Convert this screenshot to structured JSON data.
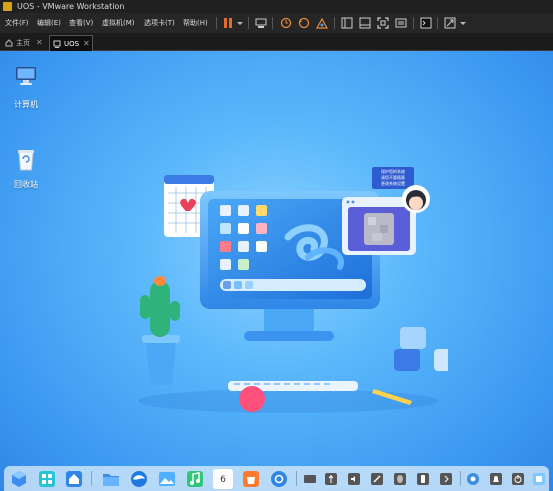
{
  "window": {
    "title": "UOS - VMware Workstation"
  },
  "menu": {
    "items": [
      "文件(F)",
      "编辑(E)",
      "查看(V)",
      "虚拟机(M)",
      "选项卡(T)",
      "帮助(H)"
    ]
  },
  "toolbar": {
    "icons": [
      "pause-icon",
      "dropdown-arrow-icon",
      "send-ctrl-alt-del-icon",
      "snapshot-icon",
      "revert-snapshot-icon",
      "snapshot-manager-icon",
      "library-view-icon",
      "unity-view-icon",
      "fullscreen-icon",
      "fit-guest-icon",
      "console-view-icon",
      "stretch-view-icon",
      "dropdown-arrow-icon"
    ]
  },
  "tabs": [
    {
      "label": "主页",
      "icon": "home-icon"
    },
    {
      "label": "UOS",
      "icon": "vm-icon"
    }
  ],
  "desktop": {
    "icons": [
      {
        "label": "计算机",
        "icon": "computer-icon"
      },
      {
        "label": "回收站",
        "icon": "trash-icon"
      }
    ],
    "illustration": {
      "bubble_text": [
        "保护您的系统",
        "请您不要随意",
        "更改系统设置"
      ]
    }
  },
  "dock": {
    "apps": [
      "multitasking-view-icon",
      "launcher-icon",
      "file-manager-icon",
      "browser-icon",
      "image-viewer-icon",
      "music-icon",
      "calendar-icon",
      "app-store-icon",
      "settings-icon"
    ],
    "tray": [
      "keyboard-icon",
      "usb-icon",
      "volume-icon",
      "pen-icon",
      "mouse-icon",
      "phone-icon",
      "network-icon",
      "expand-arrow-icon",
      "onboard-icon",
      "notification-icon",
      "power-icon",
      "show-desktop-icon"
    ],
    "calendar_day": "6",
    "colors": {
      "accent": "#2f86e6",
      "dock_bg": "#d7ebfa"
    }
  }
}
